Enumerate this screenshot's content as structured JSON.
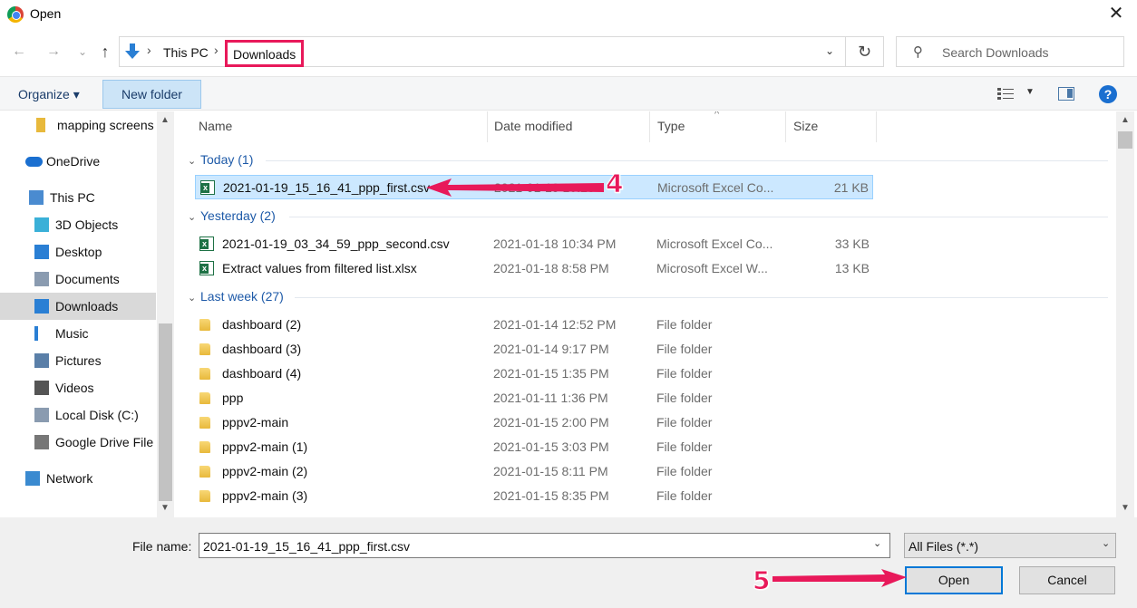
{
  "window": {
    "title": "Open",
    "close_glyph": "✕"
  },
  "nav": {
    "back": "←",
    "forward": "→",
    "recent": "⌄",
    "up": "↑",
    "breadcrumb": [
      "This PC",
      "Downloads"
    ],
    "refresh": "↻",
    "search_placeholder": "Search Downloads"
  },
  "toolbar": {
    "organize": "Organize ▾",
    "new_folder": "New folder",
    "help": "?"
  },
  "sidebar": {
    "items": [
      {
        "label": "mapping screens",
        "icon": "folder-icon"
      },
      {
        "label": "OneDrive",
        "icon": "cloud-icon"
      },
      {
        "label": "This PC",
        "icon": "computer-icon"
      },
      {
        "label": "3D Objects",
        "icon": "cube-icon"
      },
      {
        "label": "Desktop",
        "icon": "desktop-icon"
      },
      {
        "label": "Documents",
        "icon": "document-icon"
      },
      {
        "label": "Downloads",
        "icon": "download-icon",
        "selected": true
      },
      {
        "label": "Music",
        "icon": "music-icon"
      },
      {
        "label": "Pictures",
        "icon": "pictures-icon"
      },
      {
        "label": "Videos",
        "icon": "video-icon"
      },
      {
        "label": "Local Disk (C:)",
        "icon": "disk-icon"
      },
      {
        "label": "Google Drive File",
        "icon": "drive-icon"
      },
      {
        "label": "Network",
        "icon": "network-icon"
      }
    ]
  },
  "columns": {
    "name": "Name",
    "date": "Date modified",
    "type": "Type",
    "size": "Size"
  },
  "groups": [
    {
      "label": "Today (1)",
      "rows": [
        {
          "name": "2021-01-19_15_16_41_ppp_first.csv",
          "date": "2021-01-19 10:16",
          "type": "Microsoft Excel Co...",
          "size": "21 KB",
          "icon": "excel",
          "selected": true
        }
      ]
    },
    {
      "label": "Yesterday (2)",
      "rows": [
        {
          "name": "2021-01-19_03_34_59_ppp_second.csv",
          "date": "2021-01-18 10:34 PM",
          "type": "Microsoft Excel Co...",
          "size": "33 KB",
          "icon": "excel"
        },
        {
          "name": "Extract values from filtered list.xlsx",
          "date": "2021-01-18 8:58 PM",
          "type": "Microsoft Excel W...",
          "size": "13 KB",
          "icon": "excel"
        }
      ]
    },
    {
      "label": "Last week (27)",
      "rows": [
        {
          "name": "dashboard (2)",
          "date": "2021-01-14 12:52 PM",
          "type": "File folder",
          "size": "",
          "icon": "folder"
        },
        {
          "name": "dashboard (3)",
          "date": "2021-01-14 9:17 PM",
          "type": "File folder",
          "size": "",
          "icon": "folder"
        },
        {
          "name": "dashboard (4)",
          "date": "2021-01-15 1:35 PM",
          "type": "File folder",
          "size": "",
          "icon": "folder"
        },
        {
          "name": "ppp",
          "date": "2021-01-11 1:36 PM",
          "type": "File folder",
          "size": "",
          "icon": "folder"
        },
        {
          "name": "pppv2-main",
          "date": "2021-01-15 2:00 PM",
          "type": "File folder",
          "size": "",
          "icon": "folder"
        },
        {
          "name": "pppv2-main (1)",
          "date": "2021-01-15 3:03 PM",
          "type": "File folder",
          "size": "",
          "icon": "folder"
        },
        {
          "name": "pppv2-main (2)",
          "date": "2021-01-15 8:11 PM",
          "type": "File folder",
          "size": "",
          "icon": "folder"
        },
        {
          "name": "pppv2-main (3)",
          "date": "2021-01-15 8:35 PM",
          "type": "File folder",
          "size": "",
          "icon": "folder"
        }
      ]
    }
  ],
  "footer": {
    "file_name_label": "File name:",
    "file_name_value": "2021-01-19_15_16_41_ppp_first.csv",
    "filter": "All Files (*.*)",
    "open": "Open",
    "cancel": "Cancel"
  },
  "annotations": {
    "step_4": "4",
    "step_5": "5",
    "accent": "#e8195a"
  }
}
